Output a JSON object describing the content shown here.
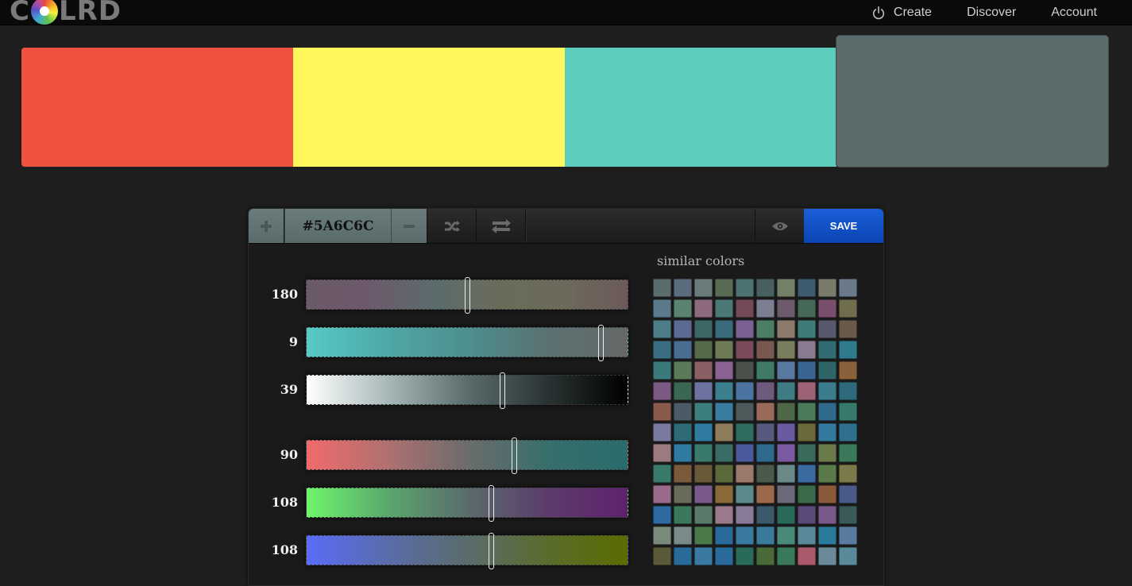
{
  "header": {
    "logo_text": "COLRD",
    "nav": [
      {
        "label": "Create",
        "icon": "power-icon"
      },
      {
        "label": "Discover"
      },
      {
        "label": "Account"
      }
    ]
  },
  "palette": [
    "#EF5340",
    "#FFF75C",
    "#5CCDBC",
    "#5A6C6C"
  ],
  "active_index": 3,
  "toolbar": {
    "hex": "#5A6C6C",
    "save_label": "SAVE"
  },
  "sliders": [
    {
      "value": "180",
      "pos": 0.5,
      "gradient": [
        "#6c5a6a",
        "#6c5a6c",
        "#5a6c6c",
        "#6a6c5a",
        "#6c6a5a",
        "#6c5a5a"
      ]
    },
    {
      "value": "9",
      "pos": 0.915,
      "gradient": [
        "#57cac8",
        "#4ea8a6",
        "#4d8f8e",
        "#5a7171",
        "#666868"
      ]
    },
    {
      "value": "39",
      "pos": 0.61,
      "gradient": [
        "#ffffff",
        "#a9b9b9",
        "#5a6c6c",
        "#2a3333",
        "#000000"
      ]
    },
    {
      "value": "90",
      "pos": 0.645,
      "gradient": [
        "#f06b6c",
        "#b07070",
        "#6c6c6c",
        "#376e6c",
        "#2a6c6c"
      ]
    },
    {
      "value": "108",
      "pos": 0.575,
      "gradient": [
        "#6ff56c",
        "#5aa86c",
        "#5a6c6c",
        "#5d3b6c",
        "#5e226c"
      ]
    },
    {
      "value": "108",
      "pos": 0.575,
      "gradient": [
        "#5a6cf8",
        "#5a6caa",
        "#5a6c6c",
        "#5a6c2c",
        "#5a6c00"
      ]
    }
  ],
  "similar": {
    "title": "similar colors",
    "colors": [
      "#5a6c6c",
      "#5b6c7d",
      "#6b7b7b",
      "#5a6b55",
      "#4c7272",
      "#486060",
      "#748069",
      "#3f5b6e",
      "#7a7b6a",
      "#6b7a8a",
      "#5b7a8c",
      "#5a8372",
      "#8e6a7f",
      "#4b7776",
      "#744a57",
      "#7b7f91",
      "#6d5a6d",
      "#456857",
      "#7a4f6d",
      "#6f6d4c",
      "#4d7d86",
      "#5c6a93",
      "#3e6767",
      "#396b7d",
      "#7a6093",
      "#4c7d65",
      "#8c7a6c",
      "#3f7b79",
      "#58596c",
      "#6a5a4b",
      "#3a6e82",
      "#4a6d93",
      "#566b49",
      "#6f7a56",
      "#7c4b5a",
      "#79594f",
      "#7a7d5c",
      "#8a7a91",
      "#336b73",
      "#2f7a8d",
      "#3a7a7c",
      "#5b7a5a",
      "#8b5f63",
      "#8b6392",
      "#4a5249",
      "#3f7a66",
      "#5a79a0",
      "#3a6592",
      "#2e6566",
      "#8a6239",
      "#7a5a82",
      "#3a6654",
      "#6d73a0",
      "#3c7f8e",
      "#4b75a0",
      "#6e5a7c",
      "#3e7b82",
      "#9c6277",
      "#3a7b8d",
      "#2f6a7c",
      "#8a5a4c",
      "#4a5a66",
      "#3d7f7d",
      "#3a7ca0",
      "#4c5a5c",
      "#9a6b58",
      "#4f6647",
      "#4a7c5c",
      "#2f6a8b",
      "#357a6a",
      "#7a7aa0",
      "#2f6b77",
      "#2f7ca0",
      "#8f7c5c",
      "#2f6d63",
      "#565a7c",
      "#6a5aa0",
      "#6a6a3a",
      "#337a9e",
      "#2f7090",
      "#9c7a80",
      "#2f7aa0",
      "#3a7a6c",
      "#3a6c66",
      "#4a5a9c",
      "#2f6a8d",
      "#7a5aa0",
      "#3a6a5a",
      "#6a7a4a",
      "#3a7a5a",
      "#3a7a6a",
      "#7a5a3a",
      "#6a5a3a",
      "#5a6a3a",
      "#9a7a6a",
      "#4a5a4a",
      "#6a8a8a",
      "#3a6aa0",
      "#5a7a4a",
      "#7a7a4a",
      "#9a6a8a",
      "#6a6a5a",
      "#7a5a8a",
      "#8a6a3a",
      "#5a8a8a",
      "#9a6a4a",
      "#6a6a7a",
      "#3a6a4a",
      "#8a5a3a",
      "#4a5a8a",
      "#2f6aa0",
      "#3a7a5a",
      "#5a7a6a",
      "#9a7a8a",
      "#8a7a9a",
      "#3a5a6a",
      "#2a6a5a",
      "#5a4a7a",
      "#7a5a8a",
      "#3a5a5a",
      "#7a8a7a",
      "#7a8a8a",
      "#4a7a4a",
      "#2a6a9a",
      "#3a7aa0",
      "#3a7a9a",
      "#4a8a7a",
      "#5a8a9a",
      "#2a7a9a",
      "#5a7aa0",
      "#5a5a3a",
      "#2a6a9a",
      "#3a7aa0",
      "#2a6a9a",
      "#2a6a5a",
      "#4a6a3a",
      "#3a7a5a",
      "#aa5a6a",
      "#6a8a9a",
      "#5a8a9a"
    ]
  }
}
